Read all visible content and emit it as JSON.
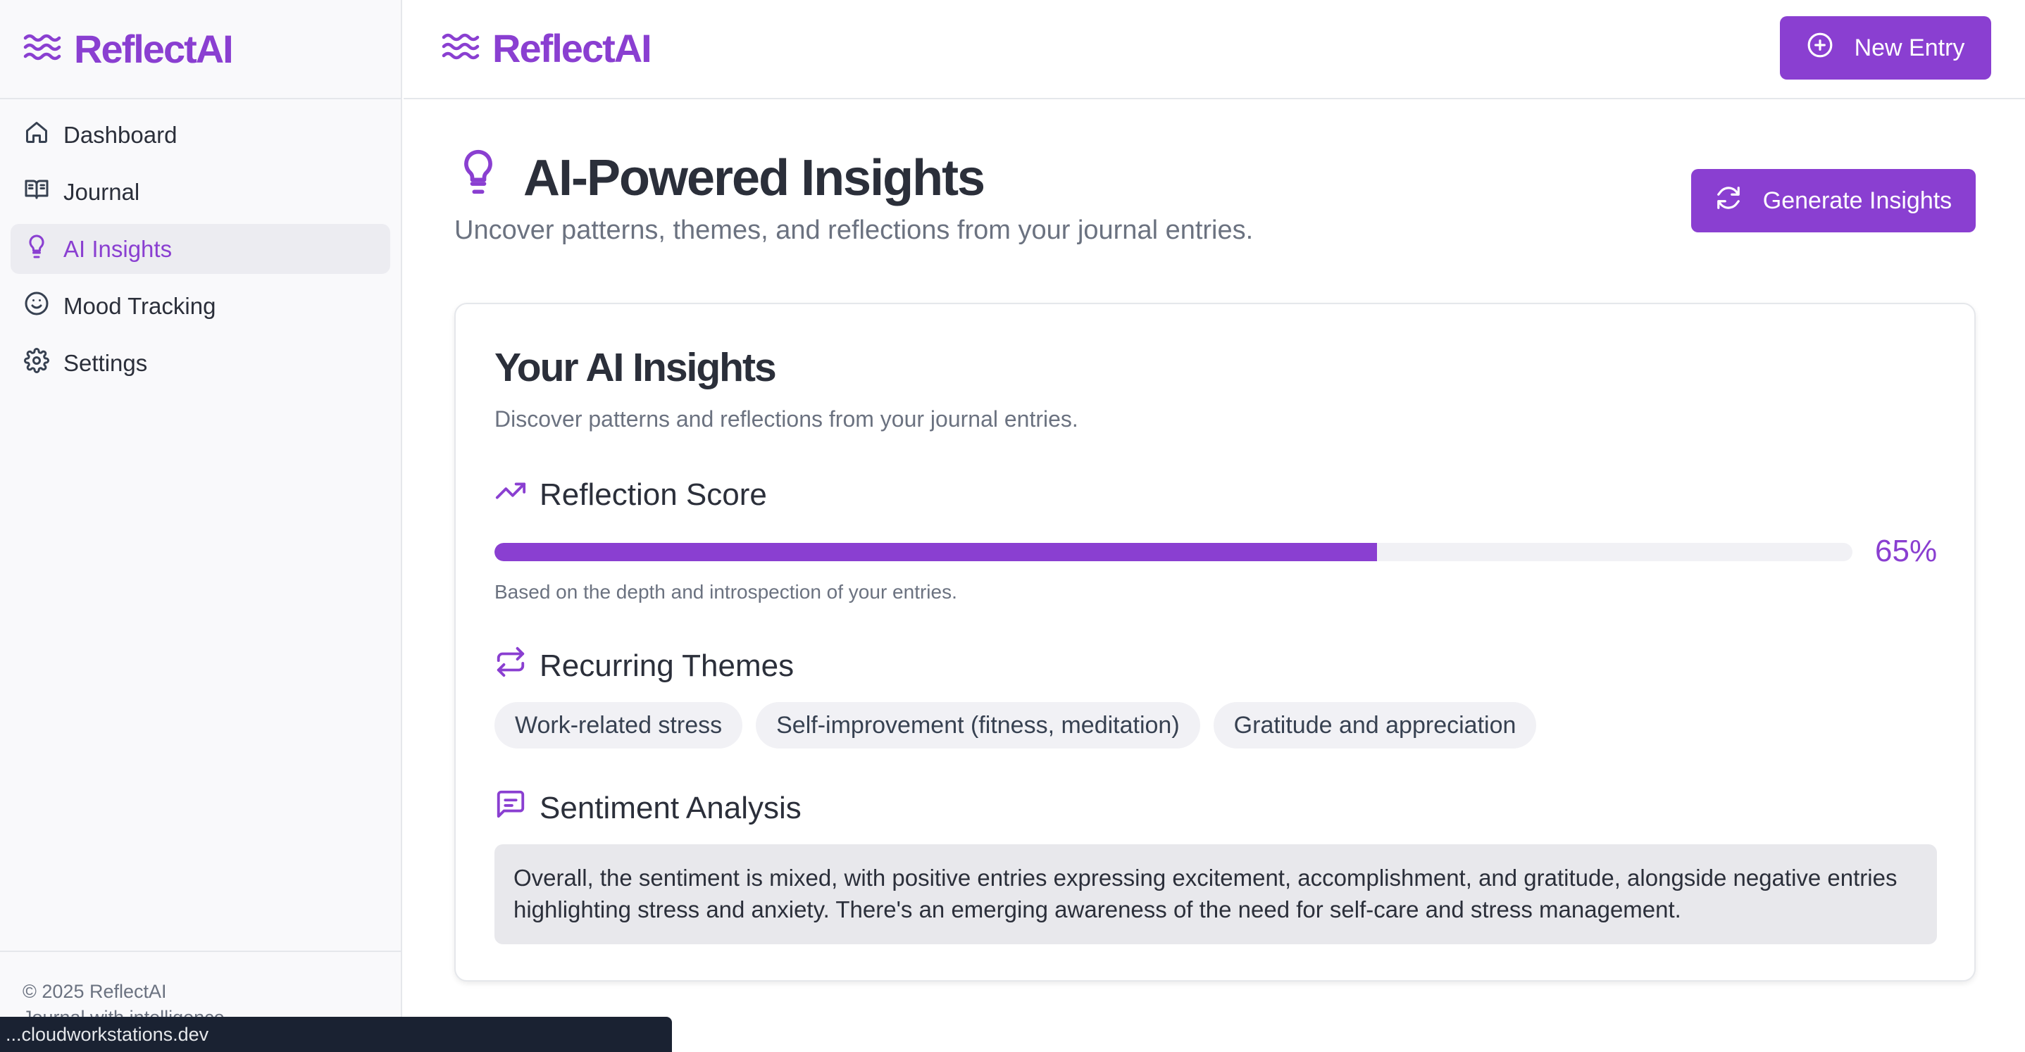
{
  "app": {
    "brand": "ReflectAI"
  },
  "sidebar": {
    "items": [
      {
        "label": "Dashboard",
        "icon": "home-icon"
      },
      {
        "label": "Journal",
        "icon": "book-open-icon"
      },
      {
        "label": "AI Insights",
        "icon": "lightbulb-icon",
        "active": true
      },
      {
        "label": "Mood Tracking",
        "icon": "smile-icon"
      },
      {
        "label": "Settings",
        "icon": "gear-icon"
      }
    ],
    "footer": {
      "copyright": "© 2025 ReflectAI",
      "tagline": "Journal with intelligence"
    }
  },
  "header": {
    "new_entry_label": "New Entry"
  },
  "page": {
    "title": "AI-Powered Insights",
    "subtitle": "Uncover patterns, themes, and reflections from your journal entries.",
    "generate_label": "Generate Insights"
  },
  "card": {
    "title": "Your AI Insights",
    "subtitle": "Discover patterns and reflections from your journal entries.",
    "reflection": {
      "heading": "Reflection Score",
      "value_percent": 65,
      "value_label": "65%",
      "note": "Based on the depth and introspection of your entries."
    },
    "themes": {
      "heading": "Recurring Themes",
      "items": [
        "Work-related stress",
        "Self-improvement (fitness, meditation)",
        "Gratitude and appreciation"
      ]
    },
    "sentiment": {
      "heading": "Sentiment Analysis",
      "text": "Overall, the sentiment is mixed, with positive entries expressing excitement, accomplishment, and gratitude, alongside negative entries highlighting stress and anxiety. There's an emerging awareness of the need for self-care and stress management."
    }
  },
  "status_bar": {
    "url": "...cloudworkstations.dev"
  },
  "colors": {
    "accent": "#8a3fd1",
    "text": "#2b2f3a",
    "muted": "#6b7280",
    "border": "#e5e7eb"
  }
}
